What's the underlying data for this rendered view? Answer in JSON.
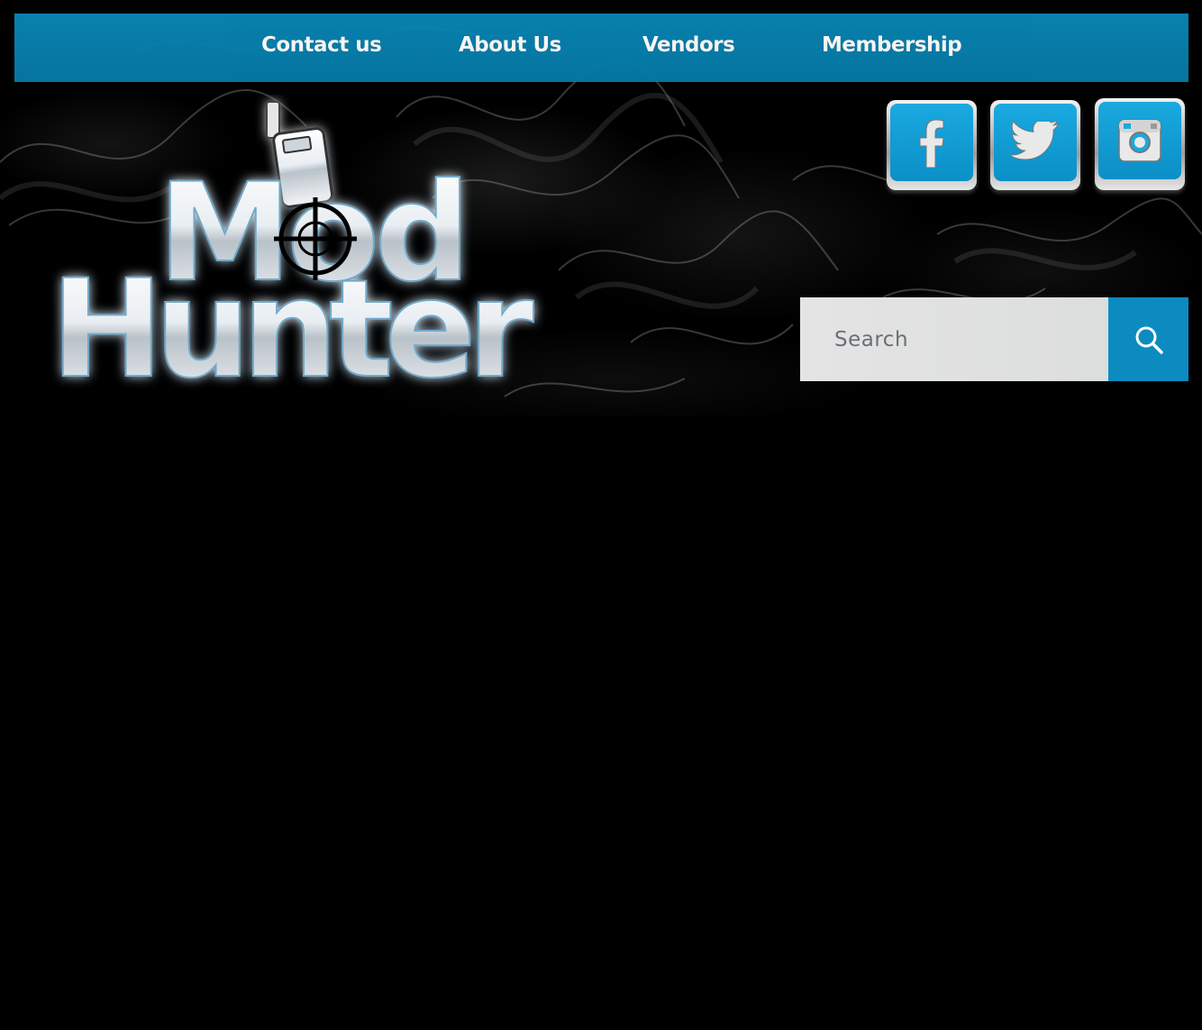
{
  "nav": {
    "items": [
      {
        "label": "Contact us"
      },
      {
        "label": "About Us"
      },
      {
        "label": "Vendors"
      },
      {
        "label": "Membership"
      }
    ]
  },
  "logo": {
    "line1": "Mod",
    "line2": "Hunter"
  },
  "social": [
    {
      "icon": "facebook-icon"
    },
    {
      "icon": "twitter-icon"
    },
    {
      "icon": "instagram-icon"
    }
  ],
  "search": {
    "placeholder": "Search",
    "button_icon": "search-icon"
  },
  "colors": {
    "nav_bg": "#0a86b4",
    "accent": "#0b8bc0",
    "social_face": "#1aa9e0",
    "background": "#000000"
  }
}
